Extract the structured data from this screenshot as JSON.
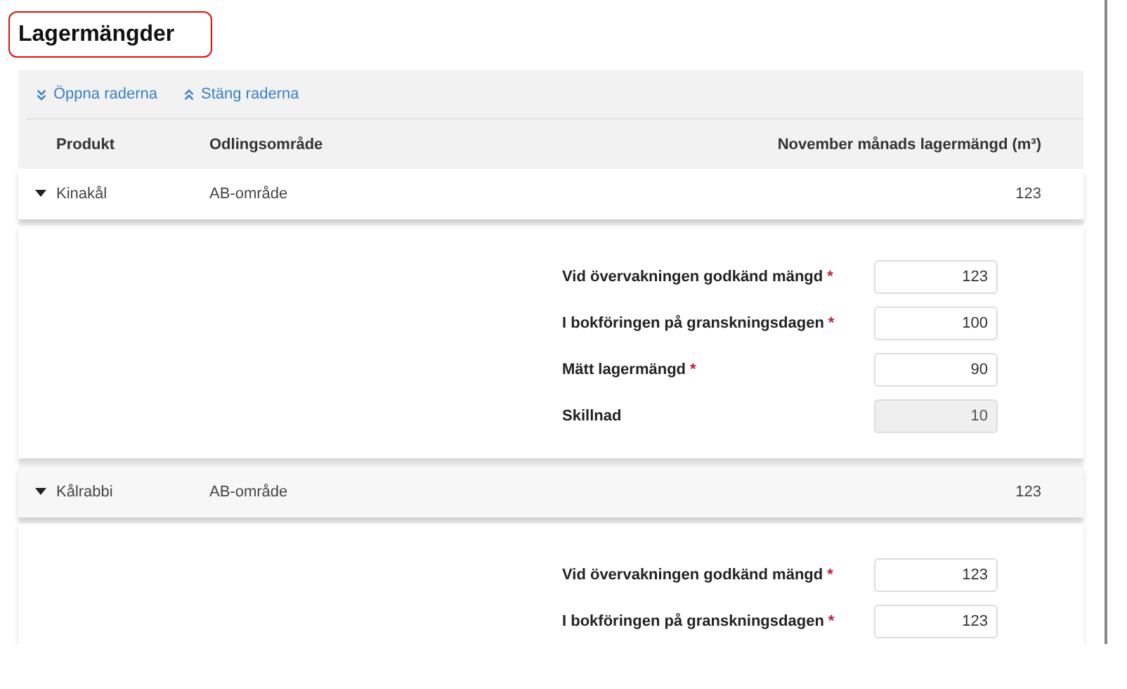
{
  "title": "Lagermängder",
  "toolbar": [
    {
      "label": "Öppna raderna",
      "kind": "expand"
    },
    {
      "label": "Stäng raderna",
      "kind": "collapse"
    }
  ],
  "table": {
    "columns": [
      "Produkt",
      "Odlingsområde",
      "November månads lagermängd (m³)"
    ],
    "rows": [
      {
        "product": "Kinakål",
        "area": "AB-område",
        "amount": "123",
        "expanded": true,
        "fields": [
          {
            "label": "Vid övervakningen godkänd mängd",
            "required_mark": "*",
            "value": "123",
            "kind": "input"
          },
          {
            "label": "I bokföringen på granskningsdagen",
            "required_mark": "*",
            "value": "100",
            "kind": "input"
          },
          {
            "label": "Mätt lagermängd",
            "required_mark": "*",
            "value": "90",
            "kind": "input"
          },
          {
            "label": "Skillnad",
            "value": "10",
            "kind": "readonly"
          }
        ]
      },
      {
        "product": "Kålrabbi",
        "area": "AB-område",
        "amount": "123",
        "expanded": true,
        "fields": [
          {
            "label": "Vid övervakningen godkänd mängd",
            "required_mark": "*",
            "value": "123",
            "kind": "input"
          },
          {
            "label": "I bokföringen på granskningsdagen",
            "required_mark": "*",
            "value": "123",
            "kind": "input"
          }
        ]
      }
    ]
  }
}
